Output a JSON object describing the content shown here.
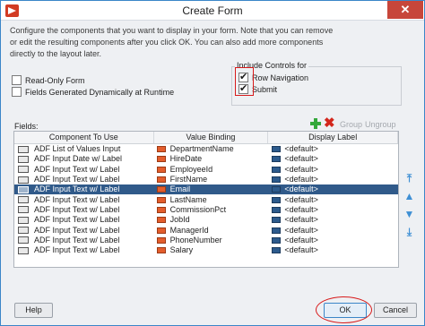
{
  "window": {
    "title": "Create Form",
    "close_glyph": "✕"
  },
  "description": "Configure the components that you want to display in your form. Note that you can remove or edit the resulting components after you click OK. You can also add more components directly to the layout later.",
  "options": {
    "read_only": {
      "label": "Read-Only Form",
      "checked": false
    },
    "dynamic": {
      "label": "Fields Generated Dynamically at Runtime",
      "checked": false
    }
  },
  "include_controls": {
    "label": "Include Controls for",
    "row_navigation": {
      "label": "Row Navigation",
      "checked": true
    },
    "submit": {
      "label": "Submit",
      "checked": true
    }
  },
  "fields": {
    "label": "Fields:",
    "toolbar": {
      "add_icon": "add-icon",
      "delete_icon": "delete-icon",
      "group_label": "Group",
      "ungroup_label": "Ungroup"
    },
    "columns": [
      "Component To Use",
      "Value Binding",
      "Display Label"
    ],
    "rows": [
      {
        "component": "ADF List of Values Input",
        "binding": "DepartmentName",
        "label": "<default>",
        "selected": false
      },
      {
        "component": "ADF Input Date w/ Label",
        "binding": "HireDate",
        "label": "<default>",
        "selected": false
      },
      {
        "component": "ADF Input Text w/ Label",
        "binding": "EmployeeId",
        "label": "<default>",
        "selected": false
      },
      {
        "component": "ADF Input Text w/ Label",
        "binding": "FirstName",
        "label": "<default>",
        "selected": false
      },
      {
        "component": "ADF Input Text w/ Label",
        "binding": "Email",
        "label": "<default>",
        "selected": true
      },
      {
        "component": "ADF Input Text w/ Label",
        "binding": "LastName",
        "label": "<default>",
        "selected": false
      },
      {
        "component": "ADF Input Text w/ Label",
        "binding": "CommissionPct",
        "label": "<default>",
        "selected": false
      },
      {
        "component": "ADF Input Text w/ Label",
        "binding": "JobId",
        "label": "<default>",
        "selected": false
      },
      {
        "component": "ADF Input Text w/ Label",
        "binding": "ManagerId",
        "label": "<default>",
        "selected": false
      },
      {
        "component": "ADF Input Text w/ Label",
        "binding": "PhoneNumber",
        "label": "<default>",
        "selected": false
      },
      {
        "component": "ADF Input Text w/ Label",
        "binding": "Salary",
        "label": "<default>",
        "selected": false
      }
    ]
  },
  "reorder_icons": [
    "move-top-icon",
    "move-up-icon",
    "move-down-icon",
    "move-bottom-icon"
  ],
  "buttons": {
    "help": "Help",
    "ok": "OK",
    "cancel": "Cancel"
  },
  "colors": {
    "selection": "#305a8a",
    "annotation": "#d81b1b",
    "accent": "#3b86c8"
  }
}
